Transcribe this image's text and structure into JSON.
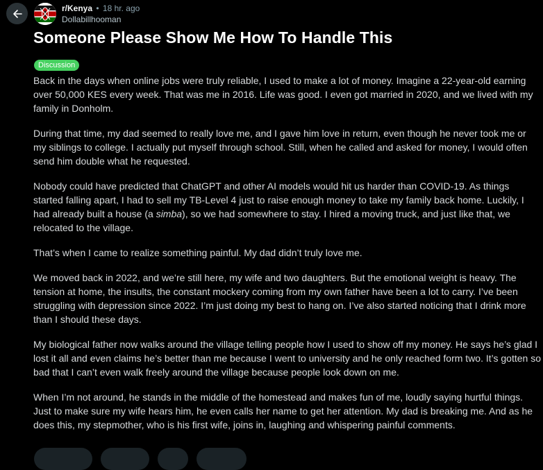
{
  "post": {
    "subreddit": "r/Kenya",
    "separator": "•",
    "time_ago": "18 hr. ago",
    "author": "Dollabillhooman",
    "title": "Someone Please Show Me How To Handle This",
    "flair": "Discussion",
    "flair_color": "#46d160",
    "paragraphs": [
      {
        "lines": [
          "Back in the days when online jobs were truly reliable, I used to make a lot of money. Imagine a 22-year-old earning",
          "over 50,000 KES every week. That was me in 2016. Life was good. I even got married in 2020, and we lived with my",
          "family in Donholm."
        ]
      },
      {
        "lines": [
          "During that time, my dad seemed to really love me, and I gave him love in return, even though he never took me or",
          "my siblings to college. I actually put myself through school. Still, when he called and asked for money, I would often",
          "send him double what he requested."
        ]
      },
      {
        "lines": [
          "Nobody could have predicted that ChatGPT and other AI models would hit us harder than COVID-19. As things",
          "started falling apart, I had to sell my TB-Level 4 just to raise enough money to take my family back home. Luckily, I"
        ],
        "line3_before": "had already built a house (a ",
        "line3_italic": "simba",
        "line3_after": "), so we had somewhere to stay. I hired a moving truck, and just like that, we",
        "line4": "relocated to the village."
      },
      {
        "lines": [
          "That’s when I came to realize something painful. My dad didn’t truly love me."
        ]
      },
      {
        "lines": [
          "We moved back in 2022, and we’re still here, my wife and two daughters. But the emotional weight is heavy. The",
          "tension at home, the insults, the constant mockery coming from my own father have been a lot to carry. I’ve been",
          "struggling with depression since 2022. I’m just doing my best to hang on. I’ve also started noticing that I drink more",
          "than I should these days."
        ]
      },
      {
        "lines": [
          "My biological father now walks around the village telling people how I used to show off my money. He says he’s glad I",
          "lost it all and even claims he’s better than me because I went to university and he only reached form two. It’s gotten so",
          "bad that I can’t even walk freely around the village because people look down on me."
        ]
      },
      {
        "lines": [
          "When I’m not around, he stands in the middle of the homestead and makes fun of me, loudly saying hurtful things.",
          "Just to make sure my wife hears him, he even calls her name to get her attention. My dad is breaking me. And as he",
          "does this, my stepmother, who is his first wife, joins in, laughing and whispering painful comments."
        ]
      }
    ]
  },
  "icons": {
    "back": "arrow-left-icon",
    "avatar": "kenya-flag-avatar"
  },
  "colors": {
    "background": "#000000",
    "text": "#d7dadc",
    "title": "#ffffff",
    "muted": "#8ba2ad",
    "back_button": "#2a3236"
  }
}
